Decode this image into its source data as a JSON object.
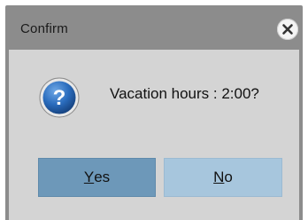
{
  "dialog": {
    "title": "Confirm",
    "close_icon": "close-icon",
    "message": "Vacation hours : 2:00?",
    "icon": "question-icon",
    "buttons": {
      "yes": {
        "mnemonic": "Y",
        "rest": "es",
        "label": "Yes"
      },
      "no": {
        "mnemonic": "N",
        "rest": "o",
        "label": "No"
      }
    }
  },
  "colors": {
    "frame": "#8c8c8c",
    "client": "#d4d4d4",
    "yes_button": "#6d98b9",
    "no_button": "#a7c6dd",
    "icon_blue": "#1f5fa8"
  }
}
